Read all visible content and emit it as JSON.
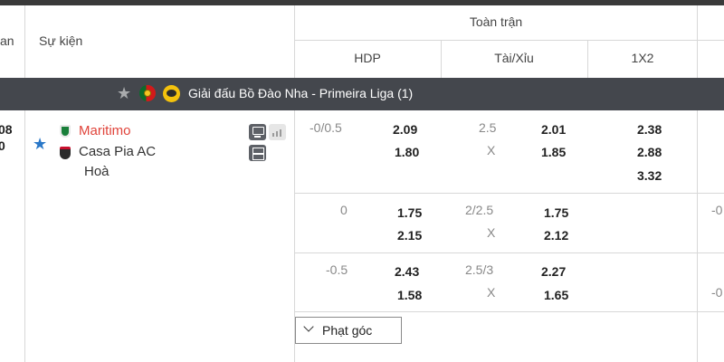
{
  "header": {
    "left_col_fragment": "an",
    "event_col": "Sự kiện",
    "full_match": "Toàn trận",
    "hdp": "HDP",
    "over_under": "Tài/Xỉu",
    "one_x_two": "1X2"
  },
  "left_fragment": {
    "line1": "08",
    "line2": "0"
  },
  "league": {
    "name": "Giải đấu Bồ Đào Nha - Primeira Liga (1)"
  },
  "match": {
    "home": "Maritimo",
    "away": "Casa Pia AC",
    "draw": "Hoà",
    "home_color": "#e0443b"
  },
  "rows": [
    {
      "hdp_line": "-0/0.5",
      "hdp_home": "2.09",
      "hdp_away": "1.80",
      "ou_line": "2.5",
      "ou_x": "X",
      "ou_over": "2.01",
      "ou_under": "1.85",
      "x12_home": "2.38",
      "x12_away": "2.88",
      "x12_draw": "3.32"
    },
    {
      "hdp_line": "0",
      "hdp_home": "1.75",
      "hdp_away": "2.15",
      "ou_line": "2/2.5",
      "ou_x": "X",
      "ou_over": "1.75",
      "ou_under": "2.12"
    },
    {
      "hdp_line": "-0.5",
      "hdp_home": "2.43",
      "hdp_away": "1.58",
      "ou_line": "2.5/3",
      "ou_x": "X",
      "ou_over": "2.27",
      "ou_under": "1.65"
    }
  ],
  "right_fragments": {
    "r2": "-0",
    "r3": "-0"
  },
  "corner_button": {
    "label": "Phạt góc",
    "icon": "chevron-down-icon"
  }
}
